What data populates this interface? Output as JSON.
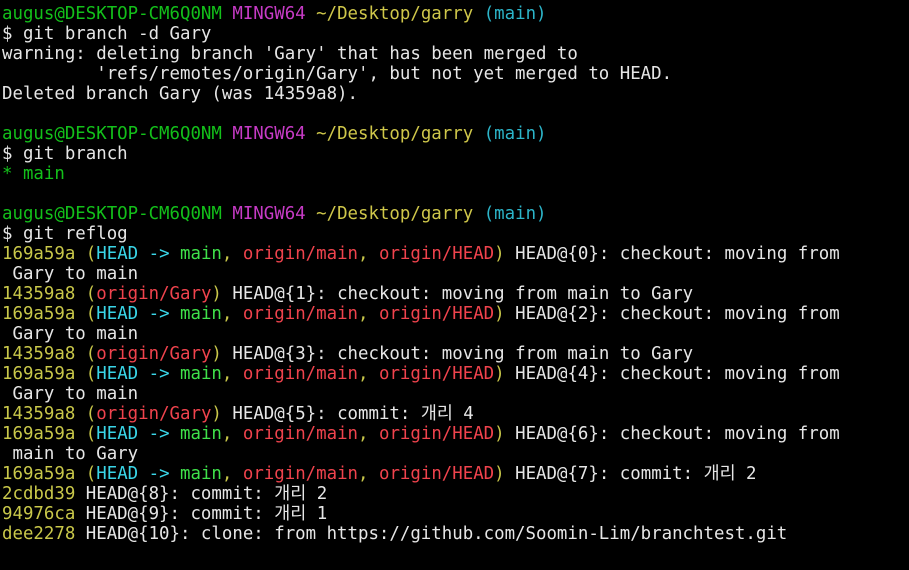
{
  "window": {
    "background": "#000000"
  },
  "colors": {
    "green": "#13c01a",
    "magenta": "#c73bc6",
    "yellow": "#cfc74a",
    "cyan": "#2cb5c9",
    "white": "#e6e6e6",
    "bright_cyan": "#3ad6e8",
    "bright_green": "#3fe14a",
    "red": "#f0434d"
  },
  "lines": [
    [
      {
        "text": "augus@DESKTOP-CM6Q0NM",
        "color": "c-green"
      },
      {
        "text": " ",
        "color": "c-white"
      },
      {
        "text": "MINGW64",
        "color": "c-magenta"
      },
      {
        "text": " ",
        "color": "c-white"
      },
      {
        "text": "~/Desktop/garry",
        "color": "c-yellow"
      },
      {
        "text": " ",
        "color": "c-white"
      },
      {
        "text": "(main)",
        "color": "c-cyan"
      }
    ],
    [
      {
        "text": "$ git branch -d Gary",
        "color": "c-white"
      }
    ],
    [
      {
        "text": "warning: deleting branch 'Gary' that has been merged to",
        "color": "c-white"
      }
    ],
    [
      {
        "text": "         'refs/remotes/origin/Gary', but not yet merged to HEAD.",
        "color": "c-white"
      }
    ],
    [
      {
        "text": "Deleted branch Gary (was 14359a8).",
        "color": "c-white"
      }
    ],
    [
      {
        "text": "",
        "color": "c-white"
      }
    ],
    [
      {
        "text": "augus@DESKTOP-CM6Q0NM",
        "color": "c-green"
      },
      {
        "text": " ",
        "color": "c-white"
      },
      {
        "text": "MINGW64",
        "color": "c-magenta"
      },
      {
        "text": " ",
        "color": "c-white"
      },
      {
        "text": "~/Desktop/garry",
        "color": "c-yellow"
      },
      {
        "text": " ",
        "color": "c-white"
      },
      {
        "text": "(main)",
        "color": "c-cyan"
      }
    ],
    [
      {
        "text": "$ git branch",
        "color": "c-white"
      }
    ],
    [
      {
        "text": "* main",
        "color": "c-green"
      }
    ],
    [
      {
        "text": "",
        "color": "c-white"
      }
    ],
    [
      {
        "text": "augus@DESKTOP-CM6Q0NM",
        "color": "c-green"
      },
      {
        "text": " ",
        "color": "c-white"
      },
      {
        "text": "MINGW64",
        "color": "c-magenta"
      },
      {
        "text": " ",
        "color": "c-white"
      },
      {
        "text": "~/Desktop/garry",
        "color": "c-yellow"
      },
      {
        "text": " ",
        "color": "c-white"
      },
      {
        "text": "(main)",
        "color": "c-cyan"
      }
    ],
    [
      {
        "text": "$ git reflog",
        "color": "c-white"
      }
    ],
    [
      {
        "text": "169a59a",
        "color": "c-gold"
      },
      {
        "text": " (",
        "color": "c-gold"
      },
      {
        "text": "HEAD -> ",
        "color": "c-bcyan"
      },
      {
        "text": "main",
        "color": "c-bgreen"
      },
      {
        "text": ", ",
        "color": "c-gold"
      },
      {
        "text": "origin/main",
        "color": "c-red"
      },
      {
        "text": ", ",
        "color": "c-gold"
      },
      {
        "text": "origin/HEAD",
        "color": "c-red"
      },
      {
        "text": ")",
        "color": "c-gold"
      },
      {
        "text": " HEAD@{0}: checkout: moving from",
        "color": "c-white"
      }
    ],
    [
      {
        "text": " Gary to main",
        "color": "c-white"
      }
    ],
    [
      {
        "text": "14359a8",
        "color": "c-gold"
      },
      {
        "text": " (",
        "color": "c-gold"
      },
      {
        "text": "origin/Gary",
        "color": "c-red"
      },
      {
        "text": ")",
        "color": "c-gold"
      },
      {
        "text": " HEAD@{1}: checkout: moving from main to Gary",
        "color": "c-white"
      }
    ],
    [
      {
        "text": "169a59a",
        "color": "c-gold"
      },
      {
        "text": " (",
        "color": "c-gold"
      },
      {
        "text": "HEAD -> ",
        "color": "c-bcyan"
      },
      {
        "text": "main",
        "color": "c-bgreen"
      },
      {
        "text": ", ",
        "color": "c-gold"
      },
      {
        "text": "origin/main",
        "color": "c-red"
      },
      {
        "text": ", ",
        "color": "c-gold"
      },
      {
        "text": "origin/HEAD",
        "color": "c-red"
      },
      {
        "text": ")",
        "color": "c-gold"
      },
      {
        "text": " HEAD@{2}: checkout: moving from",
        "color": "c-white"
      }
    ],
    [
      {
        "text": " Gary to main",
        "color": "c-white"
      }
    ],
    [
      {
        "text": "14359a8",
        "color": "c-gold"
      },
      {
        "text": " (",
        "color": "c-gold"
      },
      {
        "text": "origin/Gary",
        "color": "c-red"
      },
      {
        "text": ")",
        "color": "c-gold"
      },
      {
        "text": " HEAD@{3}: checkout: moving from main to Gary",
        "color": "c-white"
      }
    ],
    [
      {
        "text": "169a59a",
        "color": "c-gold"
      },
      {
        "text": " (",
        "color": "c-gold"
      },
      {
        "text": "HEAD -> ",
        "color": "c-bcyan"
      },
      {
        "text": "main",
        "color": "c-bgreen"
      },
      {
        "text": ", ",
        "color": "c-gold"
      },
      {
        "text": "origin/main",
        "color": "c-red"
      },
      {
        "text": ", ",
        "color": "c-gold"
      },
      {
        "text": "origin/HEAD",
        "color": "c-red"
      },
      {
        "text": ")",
        "color": "c-gold"
      },
      {
        "text": " HEAD@{4}: checkout: moving from",
        "color": "c-white"
      }
    ],
    [
      {
        "text": " Gary to main",
        "color": "c-white"
      }
    ],
    [
      {
        "text": "14359a8",
        "color": "c-gold"
      },
      {
        "text": " (",
        "color": "c-gold"
      },
      {
        "text": "origin/Gary",
        "color": "c-red"
      },
      {
        "text": ")",
        "color": "c-gold"
      },
      {
        "text": " HEAD@{5}: commit: 개리 4",
        "color": "c-white"
      }
    ],
    [
      {
        "text": "169a59a",
        "color": "c-gold"
      },
      {
        "text": " (",
        "color": "c-gold"
      },
      {
        "text": "HEAD -> ",
        "color": "c-bcyan"
      },
      {
        "text": "main",
        "color": "c-bgreen"
      },
      {
        "text": ", ",
        "color": "c-gold"
      },
      {
        "text": "origin/main",
        "color": "c-red"
      },
      {
        "text": ", ",
        "color": "c-gold"
      },
      {
        "text": "origin/HEAD",
        "color": "c-red"
      },
      {
        "text": ")",
        "color": "c-gold"
      },
      {
        "text": " HEAD@{6}: checkout: moving from",
        "color": "c-white"
      }
    ],
    [
      {
        "text": " main to Gary",
        "color": "c-white"
      }
    ],
    [
      {
        "text": "169a59a",
        "color": "c-gold"
      },
      {
        "text": " (",
        "color": "c-gold"
      },
      {
        "text": "HEAD -> ",
        "color": "c-bcyan"
      },
      {
        "text": "main",
        "color": "c-bgreen"
      },
      {
        "text": ", ",
        "color": "c-gold"
      },
      {
        "text": "origin/main",
        "color": "c-red"
      },
      {
        "text": ", ",
        "color": "c-gold"
      },
      {
        "text": "origin/HEAD",
        "color": "c-red"
      },
      {
        "text": ")",
        "color": "c-gold"
      },
      {
        "text": " HEAD@{7}: commit: 개리 2",
        "color": "c-white"
      }
    ],
    [
      {
        "text": "2cdbd39",
        "color": "c-gold"
      },
      {
        "text": " HEAD@{8}: commit: 개리 2",
        "color": "c-white"
      }
    ],
    [
      {
        "text": "94976ca",
        "color": "c-gold"
      },
      {
        "text": " HEAD@{9}: commit: 개리 1",
        "color": "c-white"
      }
    ],
    [
      {
        "text": "dee2278",
        "color": "c-gold"
      },
      {
        "text": " HEAD@{10}: clone: from https://github.com/Soomin-Lim/branchtest.git",
        "color": "c-white"
      }
    ]
  ]
}
